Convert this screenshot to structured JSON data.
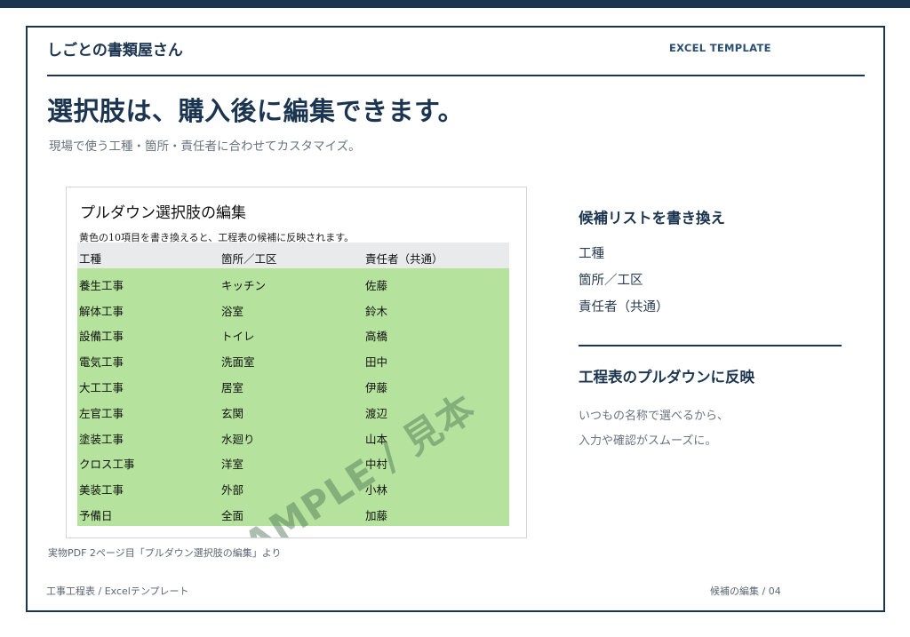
{
  "header": {
    "brand": "しごとの書類屋さん",
    "tag": "EXCEL TEMPLATE"
  },
  "hero": {
    "title": "選択肢は、購入後に編集できます。",
    "subtitle": "現場で使う工種・箇所・責任者に合わせてカスタマイズ。"
  },
  "sheet": {
    "title": "プルダウン選択肢の編集",
    "note": "黄色の10項目を書き換えると、工程表の候補に反映されます。",
    "columns": [
      "工種",
      "箇所／工区",
      "責任者（共通）"
    ],
    "rows": [
      [
        "養生工事",
        "キッチン",
        "佐藤"
      ],
      [
        "解体工事",
        "浴室",
        "鈴木"
      ],
      [
        "設備工事",
        "トイレ",
        "高橋"
      ],
      [
        "電気工事",
        "洗面室",
        "田中"
      ],
      [
        "大工工事",
        "居室",
        "伊藤"
      ],
      [
        "左官工事",
        "玄関",
        "渡辺"
      ],
      [
        "塗装工事",
        "水廻り",
        "山本"
      ],
      [
        "クロス工事",
        "洋室",
        "中村"
      ],
      [
        "美装工事",
        "外部",
        "小林"
      ],
      [
        "予備日",
        "全面",
        "加藤"
      ]
    ],
    "watermark": "SAMPLE / 見本",
    "caption": "実物PDF 2ページ目「プルダウン選択肢の編集」より"
  },
  "side": {
    "heading1": "候補リストを書き換え",
    "items": [
      "工種",
      "箇所／工区",
      "責任者（共通）"
    ],
    "heading2": "工程表のプルダウンに反映",
    "text1": "いつもの名称で選べるから、",
    "text2": "入力や確認がスムーズに。"
  },
  "footer": {
    "left": "工事工程表 / Excelテンプレート",
    "right": "候補の編集 / 04"
  },
  "colors": {
    "navy": "#1b3550",
    "highlight": "#b5e39d",
    "header_gray": "#e8eaec"
  }
}
